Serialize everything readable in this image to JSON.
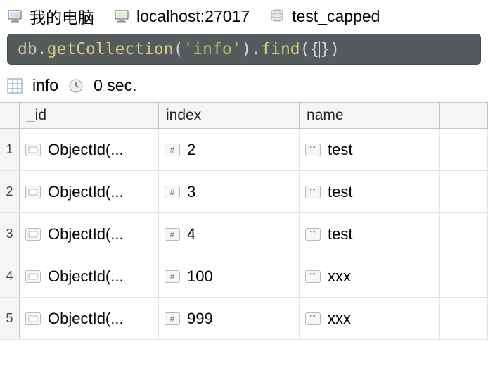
{
  "breadcrumb": {
    "computer": "我的电脑",
    "host": "localhost:27017",
    "database": "test_capped"
  },
  "query": {
    "db": "db",
    "method1": "getCollection",
    "arg1": "'info'",
    "method2": "find",
    "braces": "{}"
  },
  "info": {
    "collection": "info",
    "time": "0 sec."
  },
  "columns": {
    "id": "_id",
    "index": "index",
    "name": "name"
  },
  "rows": [
    {
      "n": "1",
      "id": "ObjectId(...",
      "index": "2",
      "name": "test"
    },
    {
      "n": "2",
      "id": "ObjectId(...",
      "index": "3",
      "name": "test"
    },
    {
      "n": "3",
      "id": "ObjectId(...",
      "index": "4",
      "name": "test"
    },
    {
      "n": "4",
      "id": "ObjectId(...",
      "index": "100",
      "name": "xxx"
    },
    {
      "n": "5",
      "id": "ObjectId(...",
      "index": "999",
      "name": "xxx"
    }
  ]
}
